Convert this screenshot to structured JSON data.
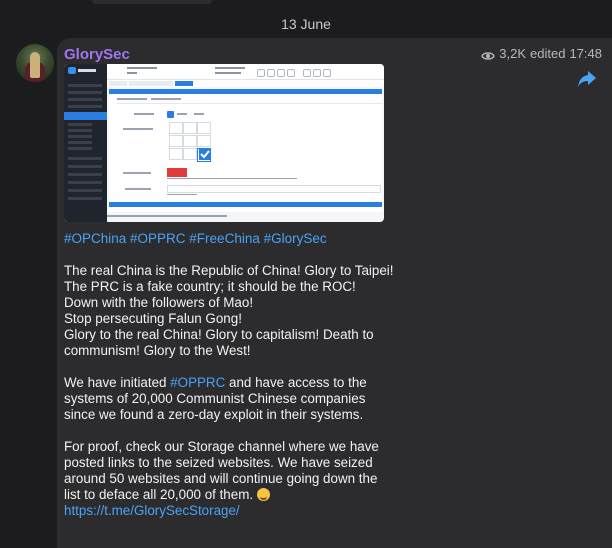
{
  "date_separator": "13 June",
  "message": {
    "sender": "GlorySec",
    "views": "3,2K",
    "edited_label": "edited",
    "time": "17:48",
    "hashtags": "#OPChina #OPPRC #FreeChina #GlorySec",
    "paragraph1": [
      "The real China is the Republic of China! Glory to Taipei!",
      "The PRC is a fake country; it should be the ROC!",
      "Down with the followers of Mao!",
      "Stop persecuting Falun Gong!",
      "Glory to the real China! Glory to capitalism! Death to communism! Glory to the West!"
    ],
    "paragraph2_before": "We have initiated ",
    "paragraph2_tag": "#OPPRC",
    "paragraph2_after": " and have access to the systems of 20,000 Communist Chinese companies since we found a zero-day exploit in their systems.",
    "paragraph3": "For proof, check our Storage channel where we have posted links to the seized websites. We have seized around 50 websites and will continue going down the list to deface all 20,000 of them.",
    "emoji": "winking-face-tongue",
    "link": "https://t.me/GlorySecStorage/"
  },
  "icons": {
    "views": "eye-icon",
    "share": "share-arrow-icon",
    "avatar": "channel-avatar"
  },
  "colors": {
    "background": "#1c1c1e",
    "bubble": "#2c2c2e",
    "sender": "#a374f0",
    "link": "#4aa3f5"
  }
}
